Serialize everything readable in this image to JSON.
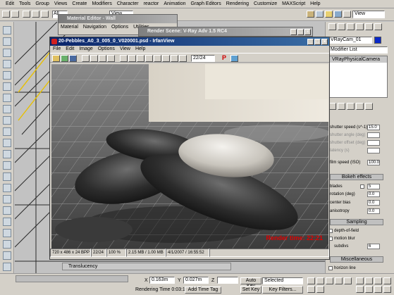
{
  "max": {
    "menu": [
      "Edit",
      "Tools",
      "Group",
      "Views",
      "Create",
      "Modifiers",
      "Character",
      "reactor",
      "Animation",
      "Graph Editors",
      "Rendering",
      "Customize",
      "MAXScript",
      "Help"
    ],
    "view_dropdown_left": "View",
    "view_dropdown_right": "View",
    "all_dropdown": "All",
    "object_name": "VRayCam_01",
    "modifier_list": "Modifier List",
    "stack_item": "VRayPhysicalCamera",
    "params": {
      "shutter_speed_label": "shutter speed (s^-1)",
      "shutter_speed_value": "15.0",
      "shutter_angle_label": "shutter angle (deg)",
      "shutter_offset_label": "shutter offset (deg)",
      "latency_label": "latency (s)",
      "iso_label": "film speed (ISO)",
      "iso_value": "100.0",
      "bokeh_title": "Bokeh effects",
      "blades_label": "blades",
      "blades_value": "5",
      "rotation_label": "rotation (deg)",
      "rotation_value": "0.0",
      "center_bias_label": "center bias",
      "center_bias_value": "0.0",
      "anisotropy_label": "anisotropy",
      "anisotropy_value": "0.0",
      "sampling_title": "Sampling",
      "depth_of_field_label": "depth-of-field",
      "motion_blur_label": "motion blur",
      "subdivs_label": "subdivs",
      "subdivs_value": "6",
      "misc_title": "Miscellaneous",
      "horizon_label": "horizon line"
    },
    "bottom": {
      "translucency": "Translucency",
      "x_value": "0.163m",
      "y_label": "Y",
      "y_value": "0.027m",
      "z_label": "Z",
      "rendering_time": "Rendering Time  0:03:15",
      "add_time_tag": "Add Time Tag",
      "auto_key": "Auto Key",
      "selected": "Selected",
      "set_key": "Set Key",
      "key_filters": "Key Filters..."
    }
  },
  "material_editor": {
    "title": "Material Editor - Wall",
    "menu": [
      "Material",
      "Navigation",
      "Options",
      "Utilities"
    ]
  },
  "render_scene": {
    "title": "Render Scene: V-Ray Adv 1.5 RC4"
  },
  "irfanview": {
    "title": "20-Pebbles_A0_3_005_0_V020001.psd - IrfanView",
    "menu": [
      "File",
      "Edit",
      "Image",
      "Options",
      "View",
      "Help"
    ],
    "page_field": "22/24",
    "render_stamp": "Render time: 22:21",
    "status": [
      "720 x 486 x 24 BPP",
      "22/24",
      "100 %",
      "2.15 MB / 1.00 MB",
      "4/1/2007 / 16:55:52"
    ]
  },
  "colors": {
    "title_active": "#0a246a",
    "title_inactive": "#808080",
    "render_stamp": "#e00000"
  }
}
